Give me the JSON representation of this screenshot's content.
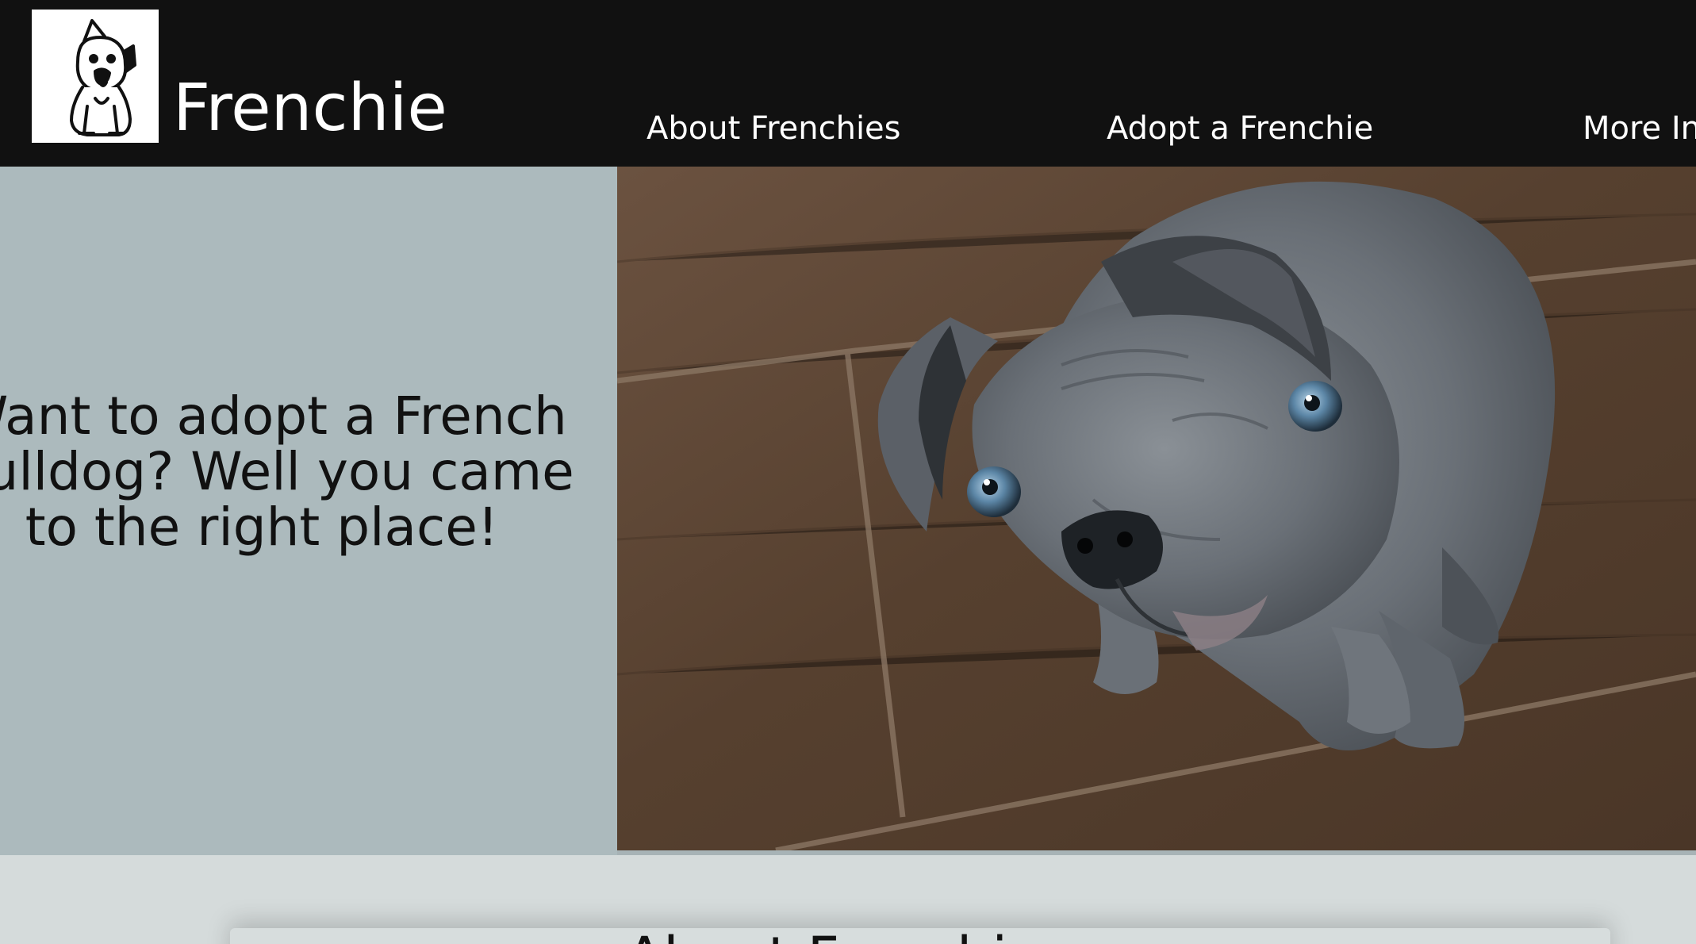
{
  "header": {
    "brand": "Frenchie",
    "nav": [
      {
        "label": "About Frenchies"
      },
      {
        "label": "Adopt a Frenchie"
      },
      {
        "label": "More Info"
      }
    ]
  },
  "hero": {
    "tagline": "Want to adopt a French Bulldog? Well you came to the right place!",
    "photo_subject": "blue french bulldog puppy on wooden floor"
  },
  "section": {
    "heading": "About Frenchies"
  },
  "colors": {
    "header_bg": "#111111",
    "hero_left_bg": "#acbabd",
    "page_bg": "#d5dbdb",
    "text_dark": "#111111",
    "text_light": "#ffffff"
  },
  "icons": {
    "logo": "french-bulldog-logo-icon"
  }
}
